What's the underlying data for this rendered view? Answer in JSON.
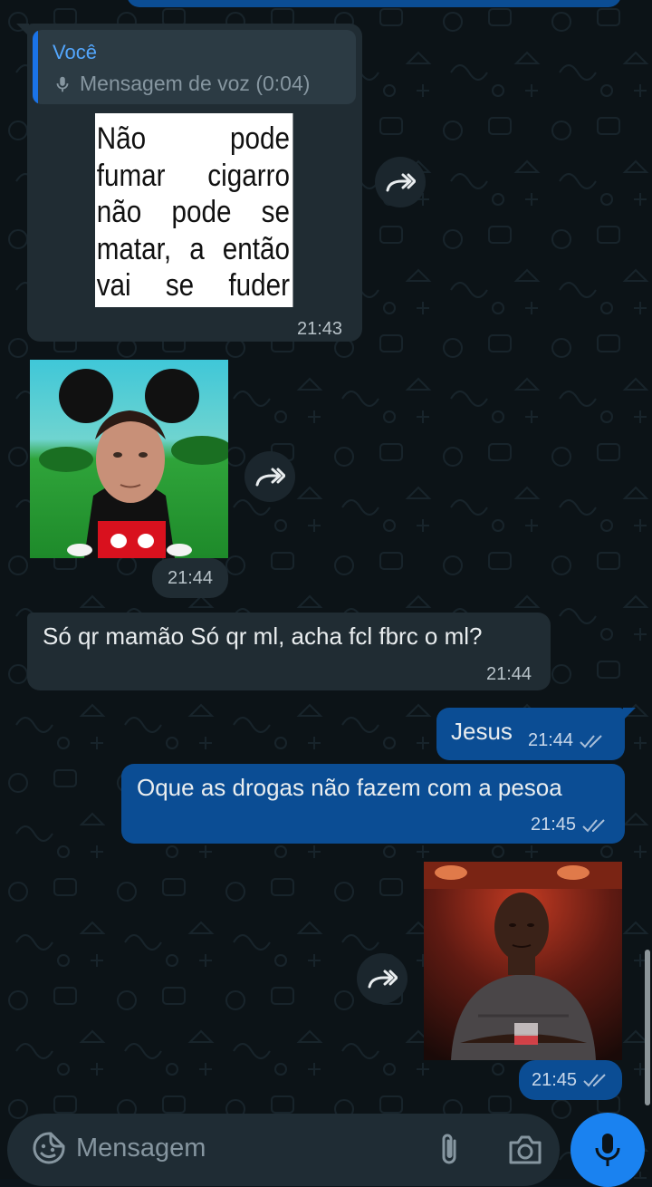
{
  "messages": {
    "reply": {
      "quote_author": "Você",
      "quote_text": "Mensagem de voz (0:04)",
      "image_text_lines": [
        [
          "Não",
          "pode"
        ],
        [
          "fumar",
          "cigarro"
        ],
        [
          "não",
          "pode",
          "se"
        ],
        [
          "matar,",
          "a",
          "então"
        ],
        [
          "vai",
          "se",
          "fuder"
        ]
      ],
      "time": "21:43"
    },
    "mickey_image": {
      "time": "21:44"
    },
    "incoming_text": {
      "text": "Só qr mamão Só qr ml, acha fcl fbrc o ml?",
      "time": "21:44"
    },
    "outgoing_1": {
      "text": "Jesus",
      "time": "21:44"
    },
    "outgoing_2": {
      "text": "Oque as drogas não fazem com a pesoa",
      "time": "21:45"
    },
    "outgoing_image": {
      "time": "21:45"
    }
  },
  "composer": {
    "placeholder": "Mensagem"
  },
  "colors": {
    "incoming_bubble": "#202c33",
    "outgoing_bubble": "#0b4d94",
    "accent_blue": "#1a82f0",
    "background": "#0b141a"
  },
  "icons": [
    "microphone-icon",
    "forward-icon",
    "double-check-icon",
    "sticker-emoji-icon",
    "paperclip-icon",
    "camera-icon"
  ]
}
